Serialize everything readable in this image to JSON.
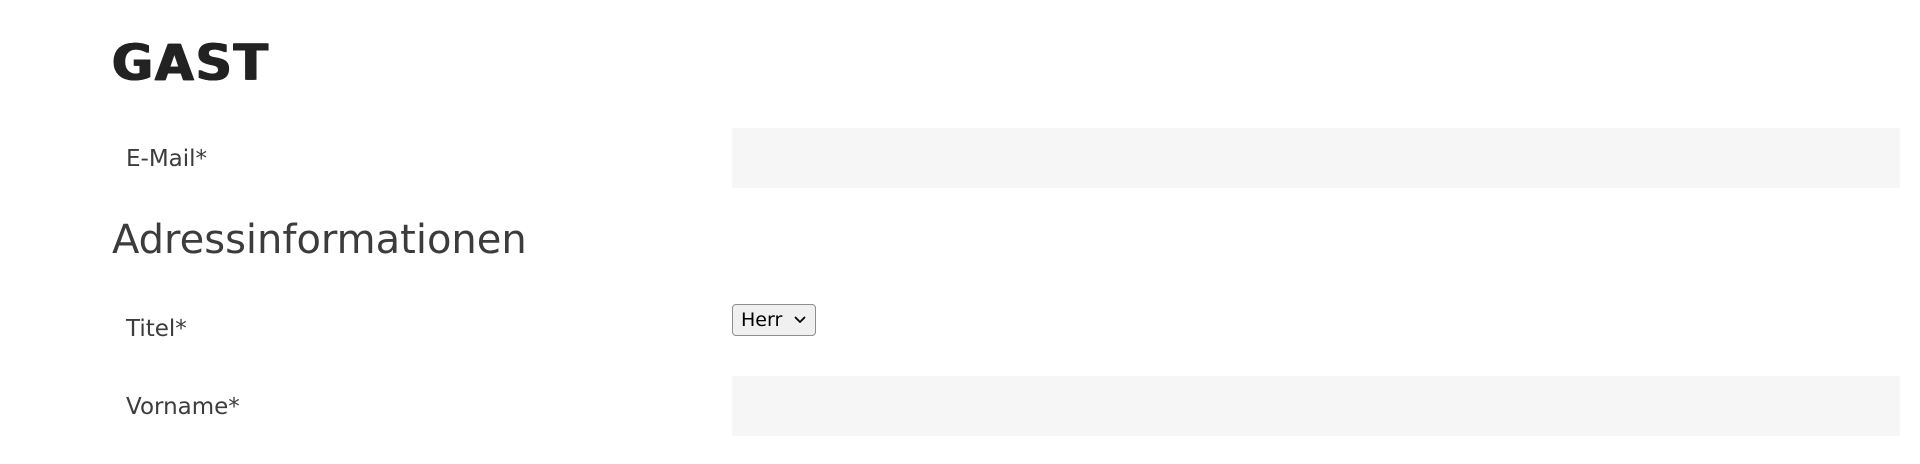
{
  "guest_section": {
    "title": "GAST"
  },
  "email_field": {
    "label": "E-Mail*",
    "value": ""
  },
  "address_section": {
    "title": "Adressinformationen"
  },
  "title_field": {
    "label": "Titel*",
    "selected": "Herr",
    "icon": "chevron-down-icon"
  },
  "firstname_field": {
    "label": "Vorname*",
    "value": ""
  },
  "colors": {
    "input_background": "#f6f6f6",
    "text": "#3c3c3c",
    "heading": "#222222"
  }
}
